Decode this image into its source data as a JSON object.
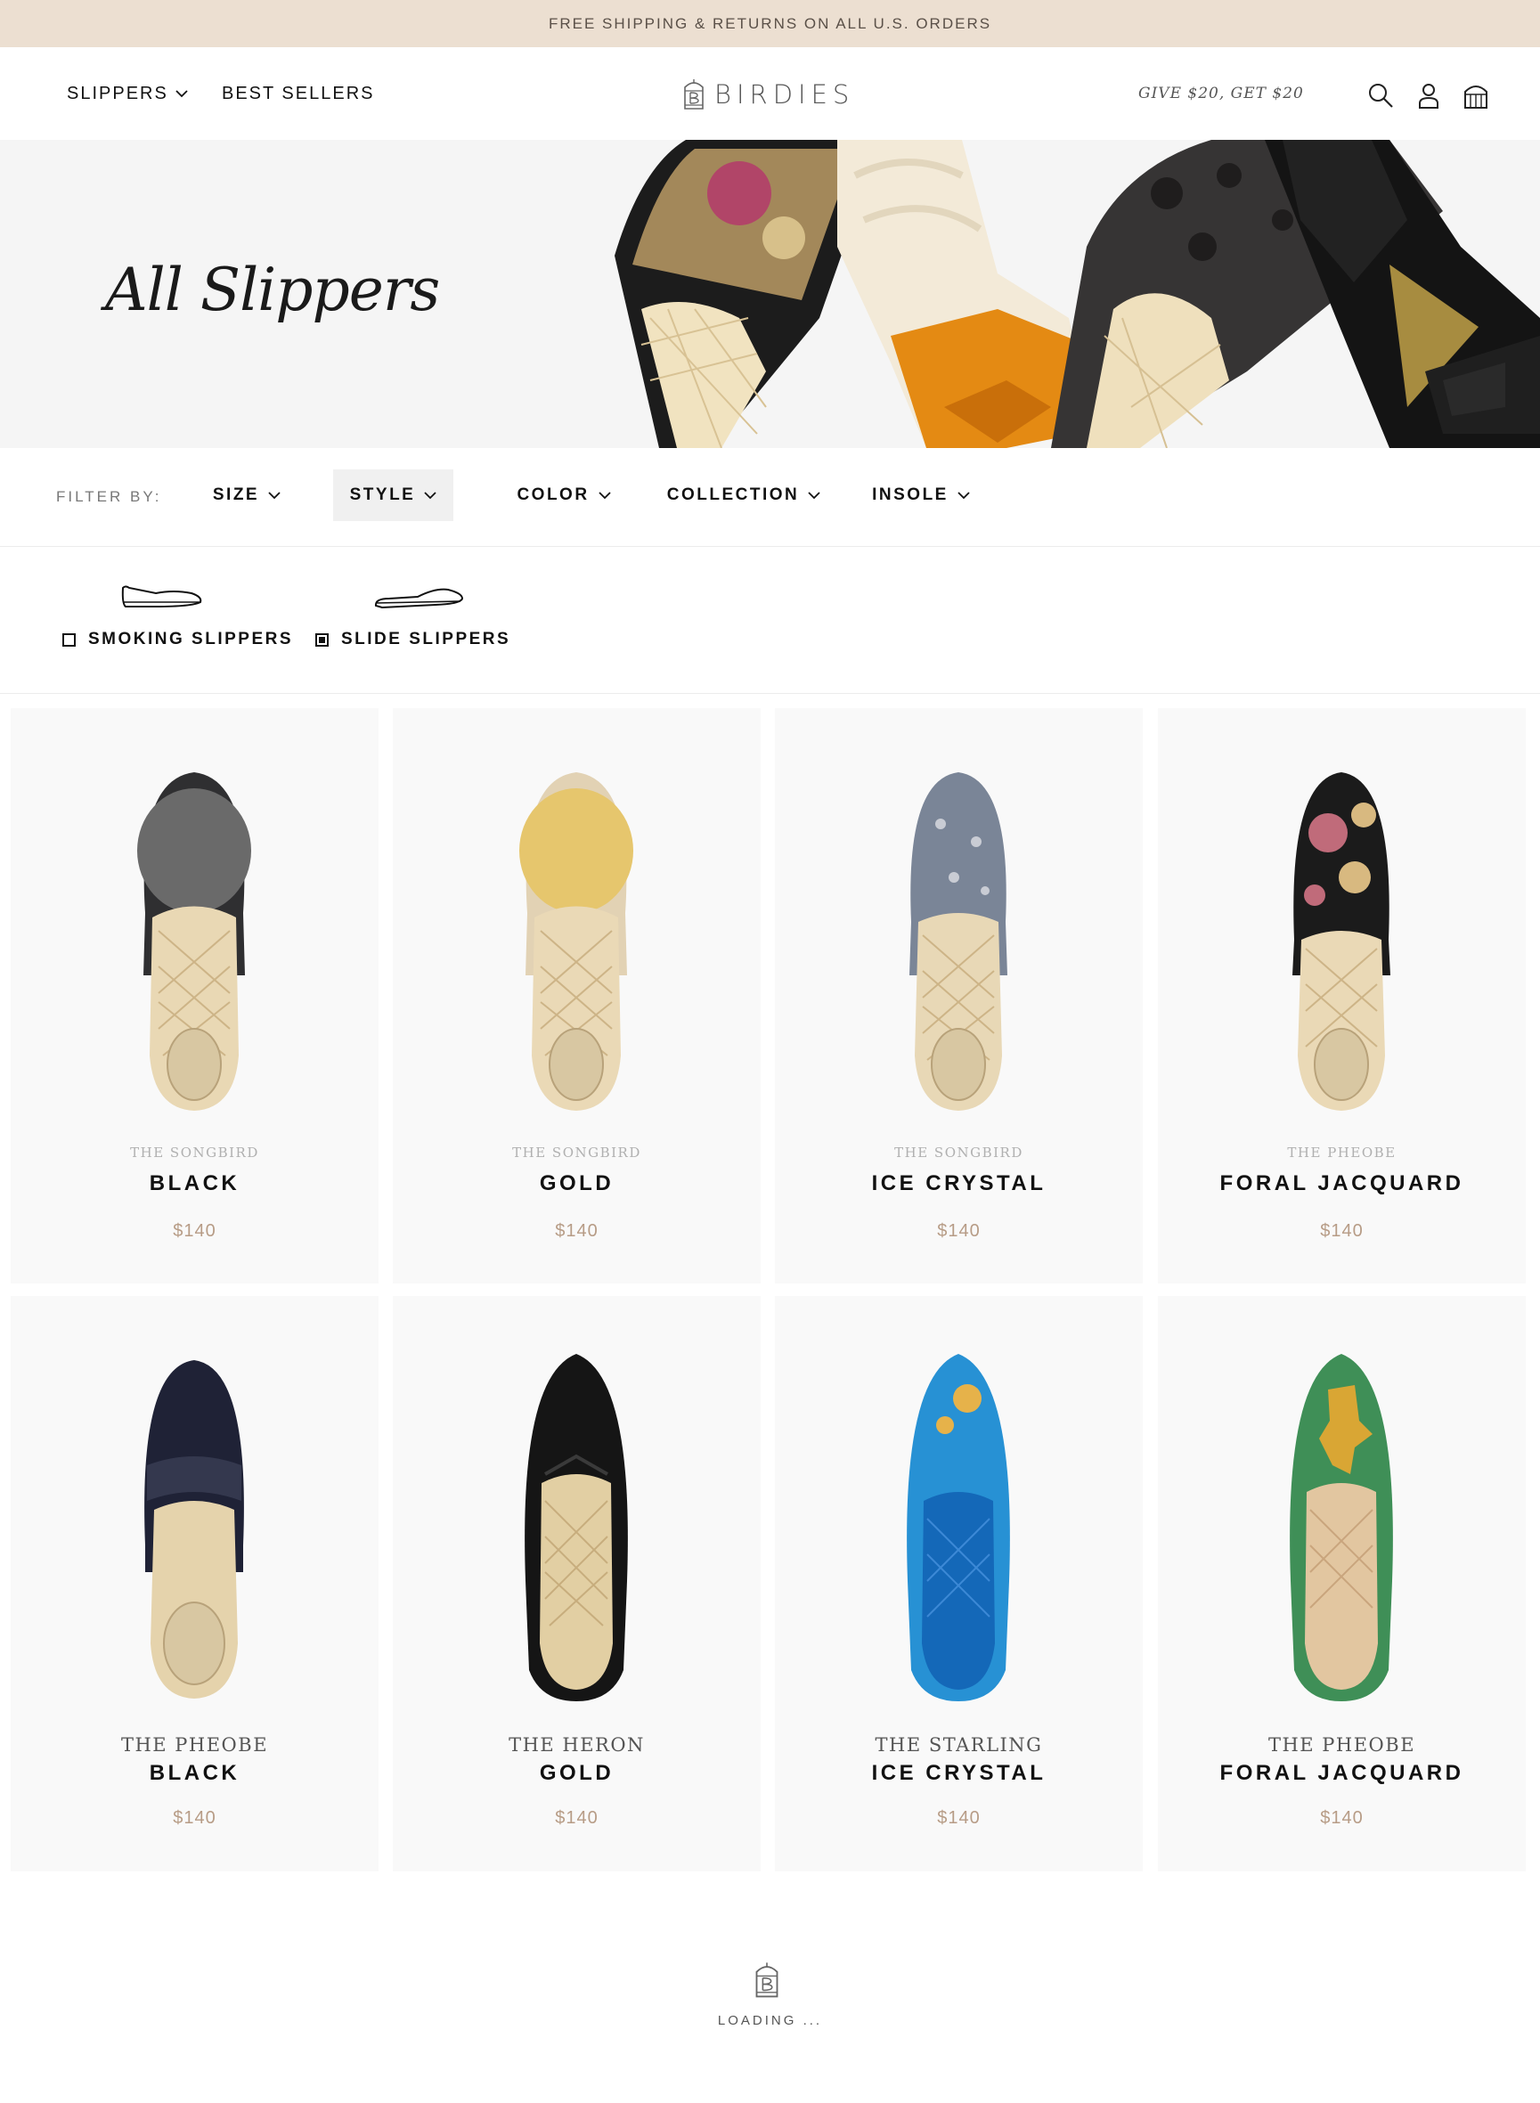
{
  "announcement": "FREE SHIPPING & RETURNS ON ALL U.S. ORDERS",
  "header": {
    "nav": [
      {
        "label": "SLIPPERS",
        "has_dropdown": true
      },
      {
        "label": "BEST SELLERS",
        "has_dropdown": false
      }
    ],
    "logo_text": "BIRDIES",
    "promo": "GIVE $20, GET $20",
    "icons": [
      "search-icon",
      "account-icon",
      "cart-icon"
    ]
  },
  "hero": {
    "title": "All Slippers"
  },
  "filters": {
    "label": "FILTER BY:",
    "buttons": [
      {
        "label": "SIZE",
        "active": false
      },
      {
        "label": "STYLE",
        "active": true
      },
      {
        "label": "COLOR",
        "active": false
      },
      {
        "label": "COLLECTION",
        "active": false
      },
      {
        "label": "INSOLE",
        "active": false
      }
    ]
  },
  "style_options": [
    {
      "label": "SMOKING SLIPPERS",
      "checked": false
    },
    {
      "label": "SLIDE SLIPPERS",
      "checked": true
    }
  ],
  "products": [
    {
      "model": "THE SONGBIRD",
      "name": "BLACK",
      "price": "$140",
      "upper": "#2f2f31",
      "accent": "#6a6a6a"
    },
    {
      "model": "THE SONGBIRD",
      "name": "GOLD",
      "price": "$140",
      "upper": "#e2d2b4",
      "accent": "#e6c66d"
    },
    {
      "model": "THE SONGBIRD",
      "name": "ICE CRYSTAL",
      "price": "$140",
      "upper": "#7a8597",
      "accent": "#c9ccd4"
    },
    {
      "model": "THE PHEOBE",
      "name": "FORAL JACQUARD",
      "price": "$140",
      "upper": "#1b1b1b",
      "accent": "#c06b7a"
    },
    {
      "model": "THE PHEOBE",
      "name": "BLACK",
      "price": "$140",
      "upper": "#1f2236",
      "accent": "#34384e"
    },
    {
      "model": "THE HERON",
      "name": "GOLD",
      "price": "$140",
      "upper": "#151515",
      "accent": "#3a3a3a"
    },
    {
      "model": "THE STARLING",
      "name": "ICE CRYSTAL",
      "price": "$140",
      "upper": "#2791d4",
      "accent": "#e6b24a"
    },
    {
      "model": "THE PHEOBE",
      "name": "FORAL JACQUARD",
      "price": "$140",
      "upper": "#3f8f57",
      "accent": "#d9a634"
    }
  ],
  "loading_text": "LOADING ..."
}
